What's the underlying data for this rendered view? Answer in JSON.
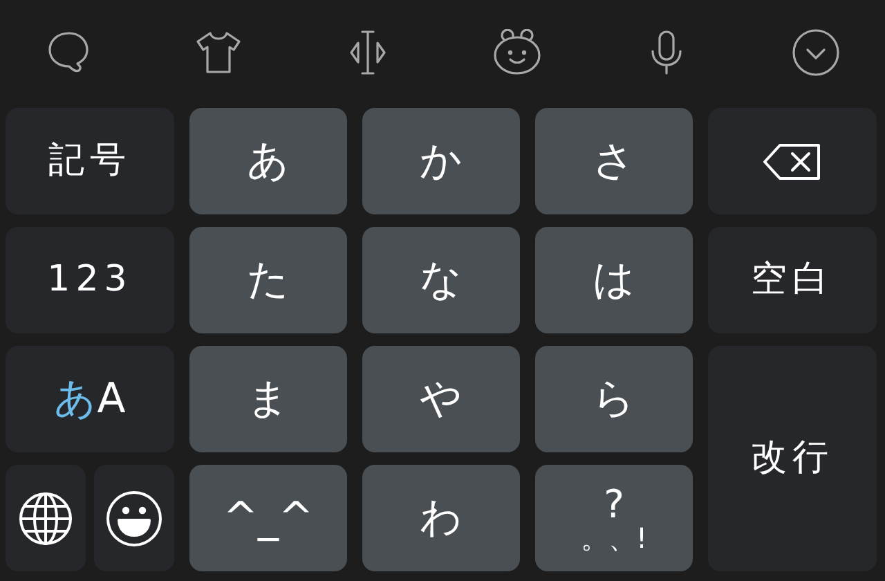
{
  "toolbar": [
    {
      "kind": "bubble"
    },
    {
      "kind": "shirt"
    },
    {
      "kind": "cursor"
    },
    {
      "kind": "bear"
    },
    {
      "kind": "mic"
    },
    {
      "kind": "collapse"
    }
  ],
  "keys": [
    {
      "kind": "dark",
      "label": "記号"
    },
    {
      "kind": "light",
      "label": "あ"
    },
    {
      "kind": "light",
      "label": "か"
    },
    {
      "kind": "light",
      "label": "さ"
    },
    {
      "kind": "backspace"
    },
    {
      "kind": "dark",
      "label": "123"
    },
    {
      "kind": "light",
      "label": "た"
    },
    {
      "kind": "light",
      "label": "な"
    },
    {
      "kind": "light",
      "label": "は"
    },
    {
      "kind": "dark",
      "label": "空白"
    },
    {
      "kind": "mode",
      "kana": "あ",
      "latin": "A"
    },
    {
      "kind": "light",
      "label": "ま"
    },
    {
      "kind": "light",
      "label": "や"
    },
    {
      "kind": "light",
      "label": "ら"
    },
    {
      "kind": "enter",
      "label": "改行"
    },
    {
      "kind": "pair",
      "keys": [
        {
          "kind": "globe"
        },
        {
          "kind": "emoji"
        }
      ]
    },
    {
      "kind": "light",
      "label": "^_^"
    },
    {
      "kind": "light",
      "label": "わ"
    },
    {
      "kind": "punct",
      "top": "?",
      "bottom": "。、!"
    }
  ]
}
